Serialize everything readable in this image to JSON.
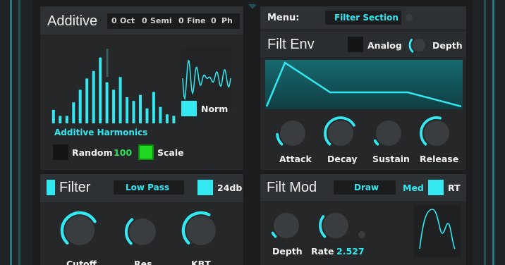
{
  "additive": {
    "title": "Additive",
    "params": [
      {
        "value": "0",
        "label": "Oct"
      },
      {
        "value": "0",
        "label": "Semi"
      },
      {
        "value": "0",
        "label": "Fine"
      },
      {
        "value": "0",
        "label": "Ph"
      }
    ],
    "harmonics_label": "Additive Harmonics",
    "harmonics": [
      0.18,
      0.1,
      0.1,
      0.28,
      0.45,
      0.6,
      0.7,
      0.88,
      0.55,
      0.45,
      0.62,
      0.35,
      0.3,
      0.38,
      0.2,
      0.42,
      0.22,
      0.12,
      0.1
    ],
    "norm_label": "Norm",
    "norm_checked": true,
    "random_label": "Random",
    "random_value": "100",
    "scale_label": "Scale",
    "scale_checked": true
  },
  "menu": {
    "label": "Menu:",
    "value": "Filter Section"
  },
  "filt_env": {
    "title": "Filt Env",
    "analog_label": "Analog",
    "analog_checked": false,
    "depth_label": "Depth",
    "depth_level": 0.3,
    "knobs": [
      {
        "label": "Attack",
        "level": 0.15
      },
      {
        "label": "Decay",
        "level": 0.72
      },
      {
        "label": "Sustain",
        "level": 0.0
      },
      {
        "label": "Release",
        "level": 0.55
      }
    ]
  },
  "filter": {
    "title": "Filter",
    "enabled": true,
    "type_value": "Low Pass",
    "db_label": "24db",
    "db_checked": true,
    "knobs": [
      {
        "label": "Cutoff",
        "level": 0.72
      },
      {
        "label": "Res",
        "level": 0.35
      },
      {
        "label": "KBT",
        "level": 0.6
      }
    ]
  },
  "filt_mod": {
    "title": "Filt Mod",
    "mode_value": "Draw",
    "med_label": "Med",
    "rt_label": "RT",
    "rt_checked": true,
    "depth_label": "Depth",
    "depth_level": 0.05,
    "rate_label": "Rate",
    "rate_value": "2.527",
    "rate_level": 0.3
  },
  "colors": {
    "accent": "#33e8f0",
    "green": "#1fd81f",
    "panel": "#252729",
    "knob": "#3a3d40"
  }
}
